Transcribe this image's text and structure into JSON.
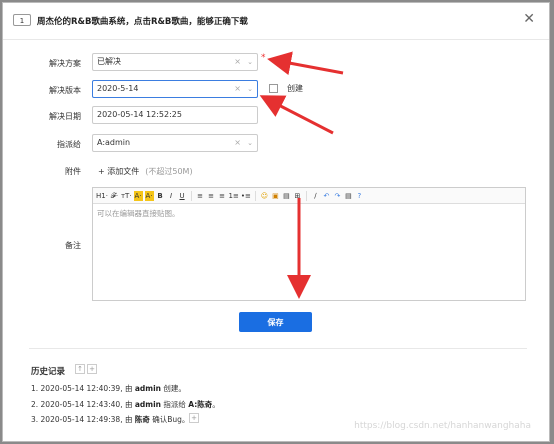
{
  "dialog": {
    "id_badge": "1",
    "title": "周杰伦的R&B歌曲系统，点击R&B歌曲，能够正确下载",
    "close_glyph": "✕"
  },
  "form": {
    "resolution_label": "解决方案",
    "resolution_value": "已解决",
    "required_mark": "*",
    "build_label": "解决版本",
    "build_value": "2020-5-14",
    "create_label": "创建",
    "date_label": "解决日期",
    "date_value": "2020-05-14 12:52:25",
    "assign_label": "指派给",
    "assign_value": "A:admin",
    "files_label": "附件",
    "add_file": "+ 添加文件",
    "add_file_hint": "(不超过50M)",
    "comment_label": "备注",
    "editor_placeholder": "可以在编辑器直接贴图。",
    "clear_glyph": "×",
    "caret_glyph": "⌄"
  },
  "toolbar": [
    "H1·",
    "𝓕·",
    "тT·",
    "A·",
    "A·",
    "B",
    "I",
    "U",
    "≡",
    "≡",
    "≡",
    "1≡",
    "•≡",
    "☺",
    "▣",
    "▤",
    "⊞",
    "∕",
    "↶",
    "↷",
    "▤",
    "?"
  ],
  "save_label": "保存",
  "history": {
    "title": "历史记录",
    "items": [
      {
        "prefix": "1. 2020-05-14 12:40:39, 由 ",
        "user": "admin",
        "suffix": " 创建。"
      },
      {
        "prefix": "2. 2020-05-14 12:43:40, 由 ",
        "user": "admin",
        "suffix": " 指派给 ",
        "target": "A:陈奇",
        "end": "。"
      },
      {
        "prefix": "3. 2020-05-14 12:49:38, 由 ",
        "user": "陈奇",
        "suffix": " 确认Bug。"
      }
    ]
  },
  "watermark": "https://blog.csdn.net/hanhanwanghaha",
  "colors": {
    "accent": "#1a6ee2",
    "annotation": "#e53030",
    "required": "#e33333"
  }
}
